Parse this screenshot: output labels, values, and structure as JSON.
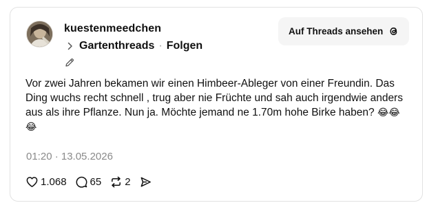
{
  "post": {
    "username": "kuestenmeedchen",
    "topic": "Gartenthreads",
    "separator": "·",
    "follow_label": "Folgen",
    "view_on_threads_label": "Auf Threads ansehen",
    "text": "Vor zwei Jahren bekamen wir einen Himbeer-Ableger von einer Freundin. Das Ding wuchs recht schnell , trug aber nie Früchte und sah auch irgendwie anders aus als ihre Pflanze. Nun ja. Möchte jemand ne 1.70m hohe Birke haben?",
    "emojis": "😂😂😂",
    "timestamp": "01:20 · 13.05.2026"
  },
  "actions": {
    "likes": "1.068",
    "replies": "65",
    "reposts": "2"
  },
  "icons": {
    "avatar": "avatar-photo",
    "topic": "chevron-right-icon",
    "edit": "pencil-icon",
    "threads": "threads-logo-icon",
    "like": "heart-icon",
    "reply": "comment-icon",
    "repost": "repost-icon",
    "share": "send-icon"
  },
  "colors": {
    "text": "#101010",
    "muted": "#8a8a8a",
    "button_bg": "#f5f5f5",
    "border": "#e1e1e1"
  }
}
